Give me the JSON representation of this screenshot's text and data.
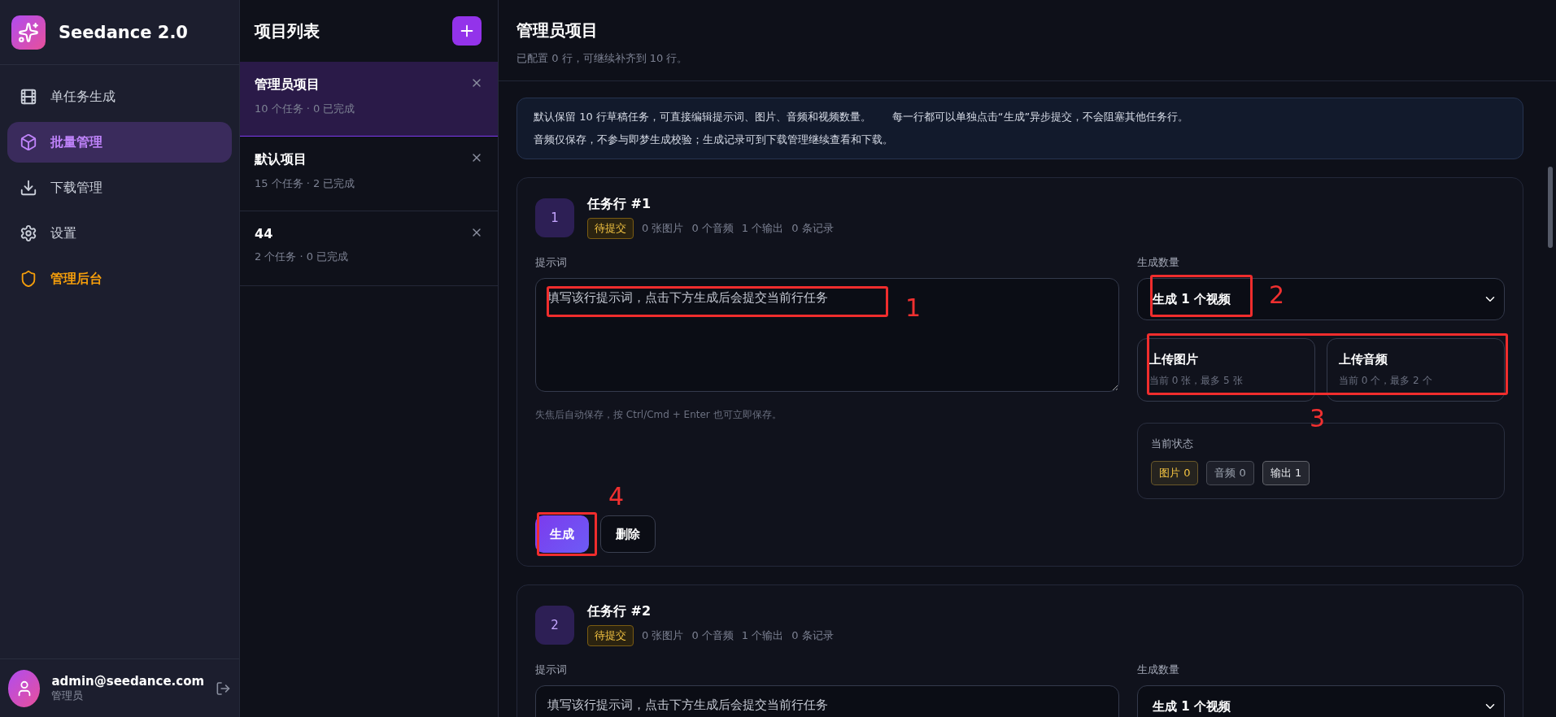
{
  "app": {
    "name": "Seedance 2.0"
  },
  "nav": [
    {
      "label": "单任务生成",
      "selected": false,
      "kind": "normal"
    },
    {
      "label": "批量管理",
      "selected": true,
      "kind": "normal"
    },
    {
      "label": "下载管理",
      "selected": false,
      "kind": "normal"
    },
    {
      "label": "设置",
      "selected": false,
      "kind": "normal"
    },
    {
      "label": "管理后台",
      "selected": false,
      "kind": "admin"
    }
  ],
  "user": {
    "email": "admin@seedance.com",
    "role": "管理员"
  },
  "projects": {
    "title": "项目列表",
    "items": [
      {
        "name": "管理员项目",
        "meta": "10 个任务 · 0 已完成",
        "selected": true
      },
      {
        "name": "默认项目",
        "meta": "15 个任务 · 2 已完成",
        "selected": false
      },
      {
        "name": "44",
        "meta": "2 个任务 · 0 已完成",
        "selected": false
      }
    ]
  },
  "main": {
    "title": "管理员项目",
    "subtitle": "已配置 0 行，可继续补齐到 10 行。",
    "notice": [
      "默认保留 10 行草稿任务，可直接编辑提示词、图片、音频和视频数量。　　每一行都可以单独点击“生成”异步提交，不会阻塞其他任务行。",
      "音频仅保存，不参与即梦生成校验；生成记录可到下载管理继续查看和下载。"
    ]
  },
  "rows": [
    {
      "index": "1",
      "title": "任务行 #1",
      "status": "待提交",
      "meta": [
        "0 张图片",
        "0 个音频",
        "1 个输出",
        "0 条记录"
      ],
      "prompt": {
        "label": "提示词",
        "placeholder": "填写该行提示词，点击下方生成后会提交当前行任务",
        "annotation": "1",
        "hint": "失焦后自动保存，按 Ctrl/Cmd + Enter 也可立即保存。"
      },
      "count": {
        "label": "生成数量",
        "value": "生成 1 个视频",
        "annotation": "2"
      },
      "uploads": {
        "annotation": "3",
        "items": [
          {
            "title": "上传图片",
            "sub": "当前 0 张，最多 5 张"
          },
          {
            "title": "上传音频",
            "sub": "当前 0 个，最多 2 个"
          }
        ]
      },
      "state": {
        "label": "当前状态",
        "chips": [
          {
            "text": "图片 0",
            "color": "#f5c542"
          },
          {
            "text": "音频 0",
            "color": "#9ca3af"
          },
          {
            "text": "输出 1",
            "color": "#e5e7eb"
          }
        ]
      },
      "actions": [
        {
          "label": "生成",
          "kind": "primary",
          "annotation": "4"
        },
        {
          "label": "删除",
          "kind": "secondary"
        }
      ]
    },
    {
      "index": "2",
      "title": "任务行 #2",
      "status": "待提交",
      "meta": [
        "0 张图片",
        "0 个音频",
        "1 个输出",
        "0 条记录"
      ],
      "prompt": {
        "label": "提示词",
        "placeholder": "填写该行提示词，点击下方生成后会提交当前行任务"
      },
      "count": {
        "label": "生成数量",
        "value": "生成 1 个视频"
      }
    }
  ]
}
